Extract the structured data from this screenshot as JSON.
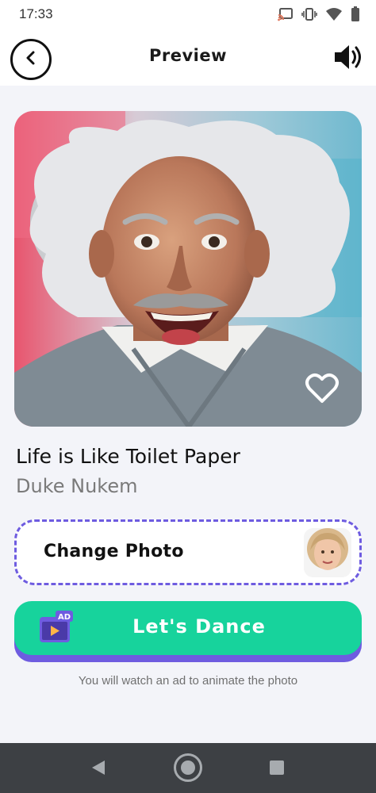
{
  "status_bar": {
    "time": "17:33",
    "icons": [
      "cast-icon",
      "vibrate-icon",
      "wifi-icon",
      "battery-icon"
    ]
  },
  "header": {
    "title": "Preview",
    "back_icon": "chevron-left-icon",
    "sound_icon": "speaker-icon"
  },
  "preview": {
    "favorite_icon": "heart-outline-icon"
  },
  "song": {
    "title": "Life is Like Toilet Paper",
    "artist": "Duke Nukem"
  },
  "change_photo": {
    "label": "Change Photo"
  },
  "dance_button": {
    "label": "Let's Dance",
    "badge": "AD"
  },
  "ad_note": "You will watch an ad to animate the photo",
  "nav": {
    "icons": [
      "nav-back-icon",
      "nav-home-icon",
      "nav-recents-icon"
    ]
  },
  "colors": {
    "accent_purple": "#6e5ce0",
    "accent_green": "#17d39c",
    "background": "#f3f4f9",
    "nav_bar": "#3d4044"
  }
}
